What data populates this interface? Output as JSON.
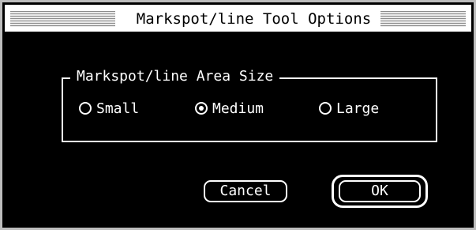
{
  "window": {
    "title": "Markspot/line Tool Options"
  },
  "group": {
    "label": "Markspot/line Area Size",
    "options": [
      {
        "label": "Small",
        "selected": false
      },
      {
        "label": "Medium",
        "selected": true
      },
      {
        "label": "Large",
        "selected": false
      }
    ]
  },
  "buttons": {
    "cancel_label": "Cancel",
    "ok_label": "OK"
  }
}
